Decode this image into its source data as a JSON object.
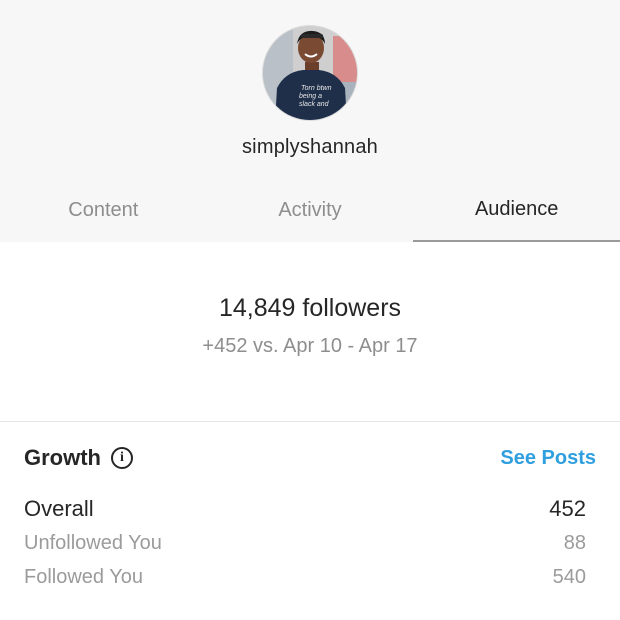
{
  "profile": {
    "username": "simplyshannah",
    "avatar_shirt_text": "Torn btwn being a slack and"
  },
  "tabs": [
    {
      "label": "Content",
      "active": false
    },
    {
      "label": "Activity",
      "active": false
    },
    {
      "label": "Audience",
      "active": true
    }
  ],
  "audience": {
    "followers_text": "14,849 followers",
    "delta_text": "+452 vs. Apr 10 - Apr 17"
  },
  "growth": {
    "title": "Growth",
    "see_posts_label": "See Posts",
    "overall_label": "Overall",
    "overall_value": "452",
    "unfollowed_label": "Unfollowed You",
    "unfollowed_value": "88",
    "followed_label": "Followed You",
    "followed_value": "540"
  },
  "colors": {
    "link": "#2f9fdf",
    "primary_text": "#262626",
    "secondary_text": "#8e8e8e",
    "header_bg": "#f7f7f7"
  }
}
